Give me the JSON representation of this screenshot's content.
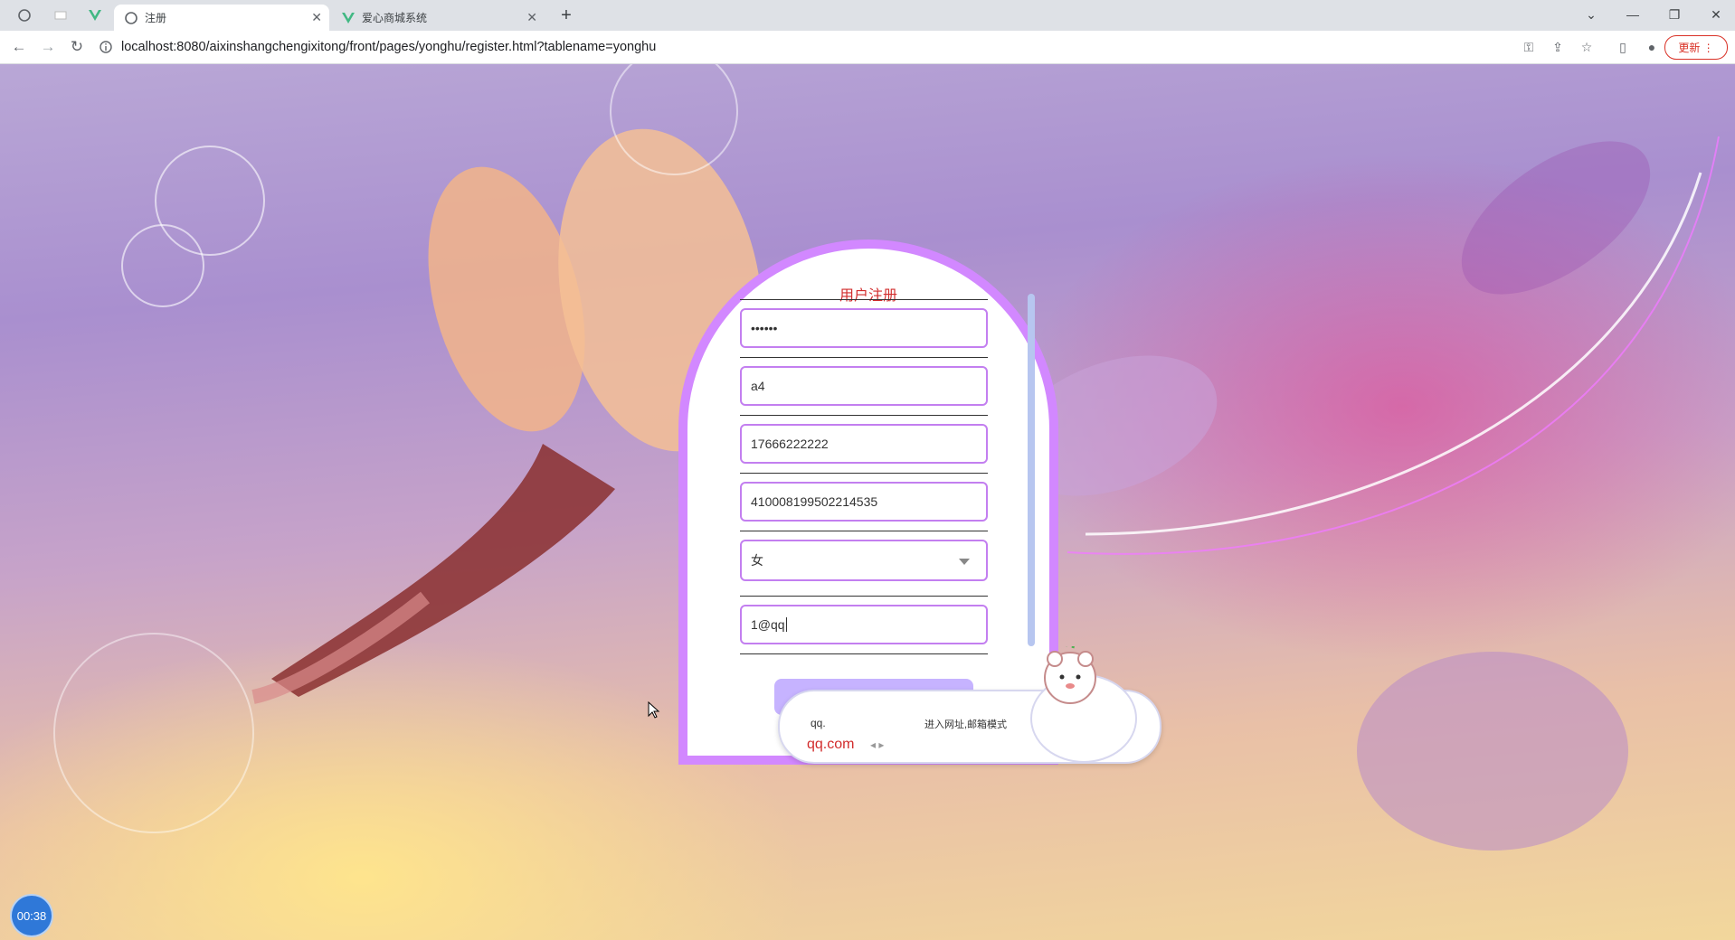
{
  "browser": {
    "tabs": [
      {
        "title": "注册",
        "active": true
      },
      {
        "title": "爱心商城系统",
        "active": false
      }
    ],
    "address": "localhost:8080/aixinshangchengixitong/front/pages/yonghu/register.html?tablename=yonghu",
    "update_label": "更新"
  },
  "form": {
    "title": "用户注册",
    "password_value": "••••••",
    "name_value": "a4",
    "phone_value": "17666222222",
    "id_number_value": "410008199502214535",
    "gender_value": "女",
    "email_value": "1@qq"
  },
  "ime": {
    "input_text": "qq.",
    "hint": "进入网址,邮箱模式",
    "candidate": "qq.com"
  },
  "timer": {
    "value": "00:38"
  },
  "colors": {
    "accent": "#d288ff",
    "title": "#d22d2d",
    "field_border": "#c37ff0"
  }
}
